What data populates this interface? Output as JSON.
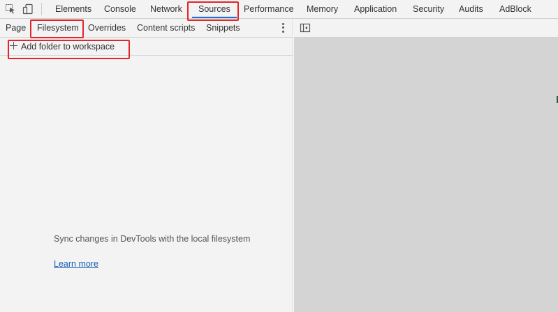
{
  "top_tabs": [
    {
      "label": "Elements"
    },
    {
      "label": "Console"
    },
    {
      "label": "Network"
    },
    {
      "label": "Sources",
      "active": true
    },
    {
      "label": "Performance"
    },
    {
      "label": "Memory"
    },
    {
      "label": "Application"
    },
    {
      "label": "Security"
    },
    {
      "label": "Audits"
    },
    {
      "label": "AdBlock"
    }
  ],
  "sources_nav": {
    "tabs": [
      {
        "label": "Page"
      },
      {
        "label": "Filesystem",
        "active": true
      },
      {
        "label": "Overrides"
      },
      {
        "label": "Content scripts"
      },
      {
        "label": "Snippets"
      }
    ],
    "add_folder_label": "Add folder to workspace",
    "message": "Sync changes in DevTools with the local filesystem",
    "learn_more": "Learn more"
  },
  "icons": {
    "inspect": "cursor-select-icon",
    "device": "device-toggle-icon",
    "more": "kebab-menu-icon",
    "plus": "plus-icon",
    "sidebar": "sidebar-toggle-icon"
  },
  "colors": {
    "active_underline": "#1a73e8",
    "highlight_box": "#e0262b",
    "link": "#1a5fb4",
    "editor_background": "#d4d4d4"
  }
}
